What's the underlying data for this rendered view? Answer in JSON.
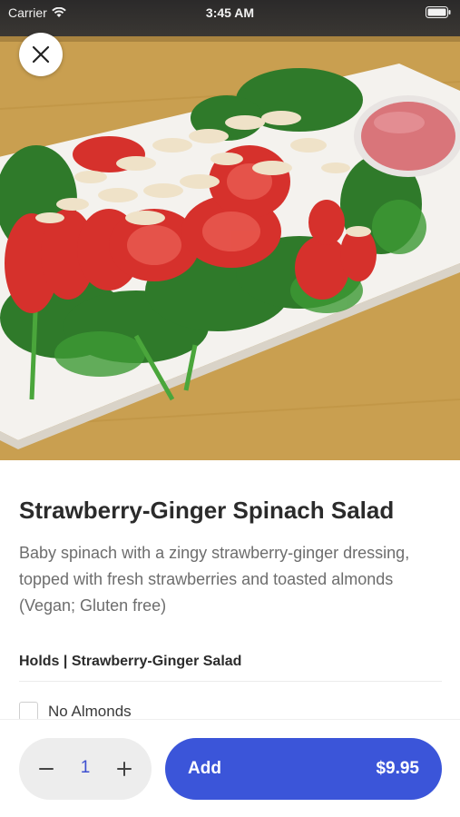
{
  "status_bar": {
    "carrier": "Carrier",
    "time": "3:45 AM"
  },
  "hero": {
    "image_alt": "Strawberry-Ginger Spinach Salad photo",
    "plate_color": "#f4f2ee",
    "table_color": "#caa15a"
  },
  "item": {
    "title": "Strawberry-Ginger Spinach Salad",
    "description": "Baby spinach with a zingy strawberry-ginger dressing, topped with fresh strawberries and toasted almonds (Vegan; Gluten free)"
  },
  "options_section": {
    "header": "Holds | Strawberry-Ginger Salad",
    "options": [
      {
        "label": "No Almonds",
        "checked": false
      }
    ]
  },
  "footer": {
    "quantity": "1",
    "add_label": "Add",
    "price": "$9.95",
    "accent_color": "#3b55d9"
  },
  "icons": {
    "close": "close-icon",
    "minus": "minus-icon",
    "plus": "plus-icon",
    "wifi": "wifi-icon",
    "battery": "battery-icon"
  }
}
